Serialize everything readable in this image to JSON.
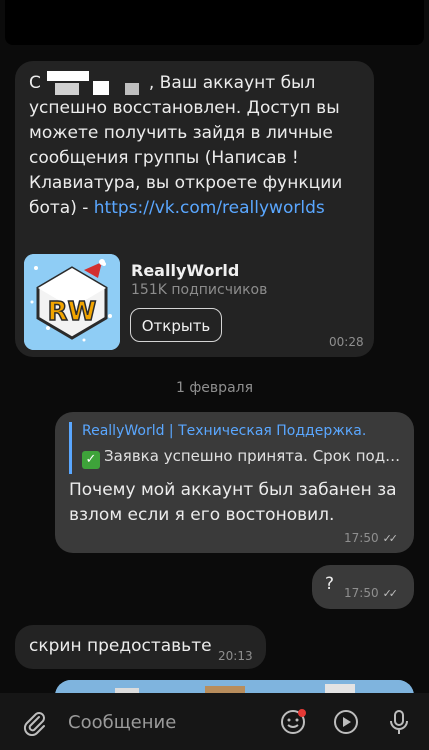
{
  "messages": {
    "restore": {
      "name_prefix": "С",
      "text_rest": ", Ваш аккаунт был успешно восстановлен. Доступ вы можете получить зайдя в личные сообщения группы (Написав !Клавиатура, вы откроете функции бота) - ",
      "link": "https://vk.com/reallyworlds",
      "card": {
        "title": "ReallyWorld",
        "subscribers": "151K подписчиков",
        "button": "Открыть",
        "logo_text": "RW"
      },
      "time": "00:28"
    },
    "date_separator": "1 февраля",
    "reply_message": {
      "reply_author": "ReallyWorld | Техническая Поддержка.",
      "reply_text": "Заявка успешно принята.    Срок подачи заявки",
      "text": "Почему мой аккаунт был забанен за взлом если я его востоновил.",
      "time": "17:50"
    },
    "question": {
      "text": "?",
      "time": "17:50"
    },
    "screenshot_request": {
      "text": "скрин предоставьте",
      "time": "20:13"
    }
  },
  "input": {
    "placeholder": "Сообщение",
    "icons": [
      "paperclip-icon",
      "sticker-icon",
      "play-icon",
      "microphone-icon"
    ]
  },
  "colors": {
    "accent": "#5aa7ff",
    "bubble_in": "#232323",
    "bubble_out": "#3a3a3a"
  }
}
